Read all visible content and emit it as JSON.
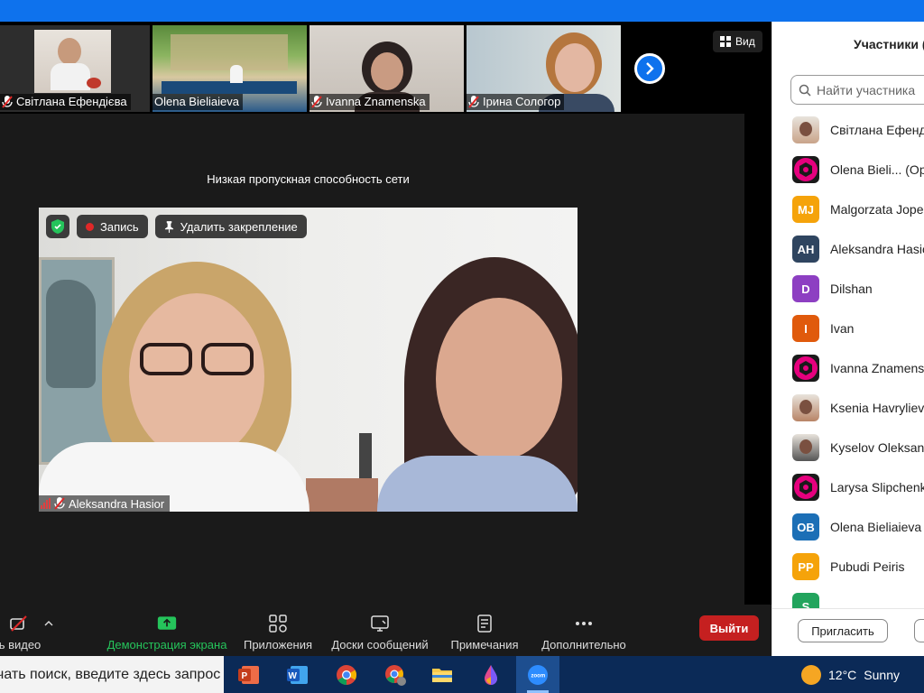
{
  "stage": {
    "view_label": "Вид",
    "bandwidth_notice": "Низкая пропускная способность сети",
    "thumbnails": [
      {
        "name": "Світлана Ефендієва",
        "muted": true
      },
      {
        "name": "Olena Bieliaieva",
        "muted": false
      },
      {
        "name": "Ivanna Znamenska",
        "muted": true
      },
      {
        "name": "Ірина Сологор",
        "muted": true
      }
    ],
    "main_video": {
      "name": "Aleksandra Hasior",
      "record_label": "Запись",
      "unpin_label": "Удалить закрепление"
    }
  },
  "toolbar": {
    "video_label": "ь видео",
    "share_label": "Демонстрация экрана",
    "apps_label": "Приложения",
    "whiteboards_label": "Доски сообщений",
    "notes_label": "Примечания",
    "more_label": "Дополнительно",
    "leave_label": "Выйти"
  },
  "panel": {
    "title": "Участники (",
    "search_placeholder": "Найти участника",
    "invite_label": "Пригласить",
    "participants": [
      {
        "name": "Світлана Ефенді",
        "initials": "",
        "color": "#c9a48a",
        "type": "photo"
      },
      {
        "name": "Olena Bieli...   (Ор",
        "initials": "",
        "color": "#e6007e",
        "type": "logo"
      },
      {
        "name": "Malgorzata Jope",
        "initials": "MJ",
        "color": "#f5a30a",
        "type": "initials"
      },
      {
        "name": "Aleksandra Hasio",
        "initials": "AH",
        "color": "#2f4560",
        "type": "initials"
      },
      {
        "name": "Dilshan",
        "initials": "D",
        "color": "#8d3fc2",
        "type": "initials"
      },
      {
        "name": "Ivan",
        "initials": "I",
        "color": "#e05a0c",
        "type": "initials"
      },
      {
        "name": "Ivanna Znamensk",
        "initials": "",
        "color": "#e6007e",
        "type": "logo"
      },
      {
        "name": "Ksenia Havrylieva",
        "initials": "",
        "color": "#b88466",
        "type": "photo"
      },
      {
        "name": "Kyselov Oleksand",
        "initials": "",
        "color": "#555555",
        "type": "photo"
      },
      {
        "name": "Larysa Slipchenko",
        "initials": "",
        "color": "#e6007e",
        "type": "logo"
      },
      {
        "name": "Olena Bieliaieva",
        "initials": "OB",
        "color": "#1c6fb6",
        "type": "initials"
      },
      {
        "name": "Pubudi Peiris",
        "initials": "PP",
        "color": "#f5a30a",
        "type": "initials"
      },
      {
        "name": "",
        "initials": "S",
        "color": "#22a45d",
        "type": "initials"
      }
    ]
  },
  "taskbar": {
    "search_text": "чать поиск, введите здесь запрос",
    "weather_temp": "12°C",
    "weather_text": "Sunny"
  }
}
